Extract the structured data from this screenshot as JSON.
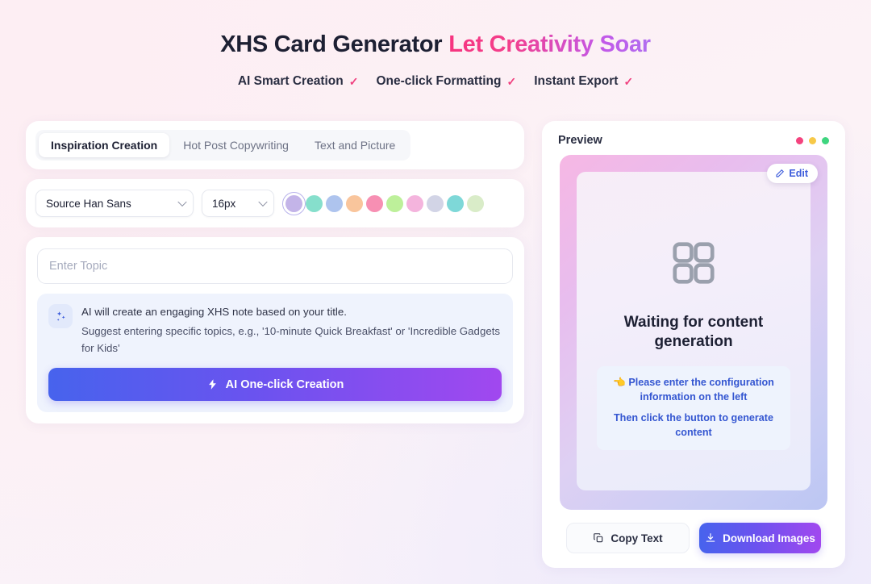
{
  "header": {
    "title_main": "XHS Card Generator",
    "title_accent": "Let Creativity Soar",
    "features": [
      {
        "label": "AI Smart Creation",
        "tick": "check-icon"
      },
      {
        "label": "One-click Formatting",
        "tick": "check-icon"
      },
      {
        "label": "Instant Export",
        "tick": "check-icon"
      }
    ]
  },
  "tabs": [
    {
      "label": "Inspiration Creation",
      "active": true
    },
    {
      "label": "Hot Post Copywriting",
      "active": false
    },
    {
      "label": "Text and Picture",
      "active": false
    }
  ],
  "toolbar": {
    "font_value": "Source Han Sans",
    "size_value": "16px",
    "swatches": [
      {
        "color": "#c3b4e8",
        "selected": true
      },
      {
        "color": "#86dfcc",
        "selected": false
      },
      {
        "color": "#aec4ee",
        "selected": false
      },
      {
        "color": "#f9c59c",
        "selected": false
      },
      {
        "color": "#f78fb3",
        "selected": false
      },
      {
        "color": "#bdf09a",
        "selected": false
      },
      {
        "color": "#f4b4dd",
        "selected": false
      },
      {
        "color": "#d2d4e6",
        "selected": false
      },
      {
        "color": "#7ed8d8",
        "selected": false
      },
      {
        "color": "#d9ecc8",
        "selected": false
      }
    ]
  },
  "prompt": {
    "topic_placeholder": "Enter Topic",
    "topic_value": "",
    "hint_icon": "sparkles-icon",
    "hint_line1": "AI will create an engaging XHS note based on your title.",
    "hint_line2": "Suggest entering specific topics, e.g., '10-minute Quick Breakfast' or 'Incredible Gadgets for Kids'",
    "cta_icon": "lightning-icon",
    "cta_label": "AI One-click Creation"
  },
  "preview": {
    "title": "Preview",
    "window_dots": [
      "#f4437e",
      "#f7c948",
      "#3ed57f"
    ],
    "edit_icon": "pencil-icon",
    "edit_label": "Edit",
    "placeholder_icon": "grid-icon",
    "waiting_title": "Waiting for content generation",
    "info_hand": "👈",
    "info_line1": "Please enter the configuration information on the left",
    "info_line2": "Then click the button to generate content",
    "copy_icon": "copy-icon",
    "copy_label": "Copy Text",
    "download_icon": "download-icon",
    "download_label": "Download Images"
  },
  "colors": {
    "accent_pink": "#f0407f",
    "accent_purple": "#a148ef",
    "accent_blue": "#3456d1",
    "page_bg": "#fdeff4"
  }
}
